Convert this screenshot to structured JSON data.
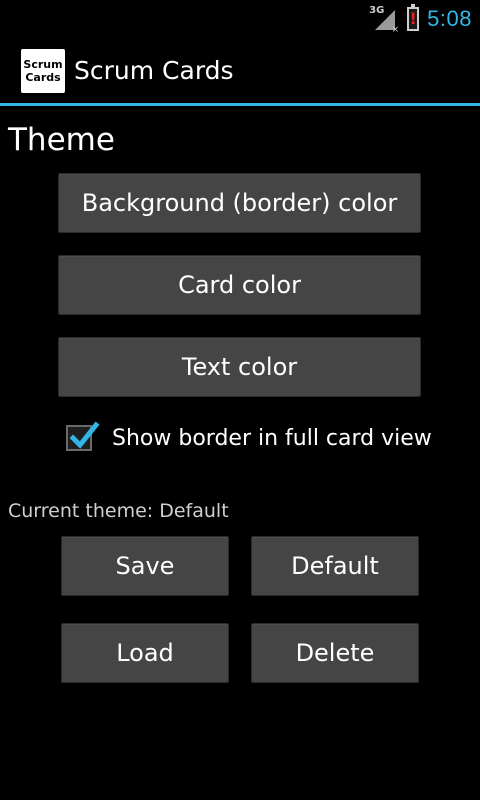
{
  "status_bar": {
    "network": "3G",
    "network_x": "×",
    "battery_alert": "!",
    "time": "5:08",
    "accent_color": "#33b5e5",
    "icons": [
      "signal-icon",
      "battery-alert-icon"
    ]
  },
  "action_bar": {
    "icon_line1": "Scrum",
    "icon_line2": "Cards",
    "title": "Scrum Cards"
  },
  "theme": {
    "heading": "Theme",
    "buttons": {
      "background": "Background (border) color",
      "card": "Card color",
      "text": "Text color"
    },
    "checkbox": {
      "label": "Show border in full card view",
      "checked": true
    },
    "current_theme": "Current theme: Default",
    "actions": {
      "save": "Save",
      "default": "Default",
      "load": "Load",
      "delete": "Delete"
    }
  }
}
